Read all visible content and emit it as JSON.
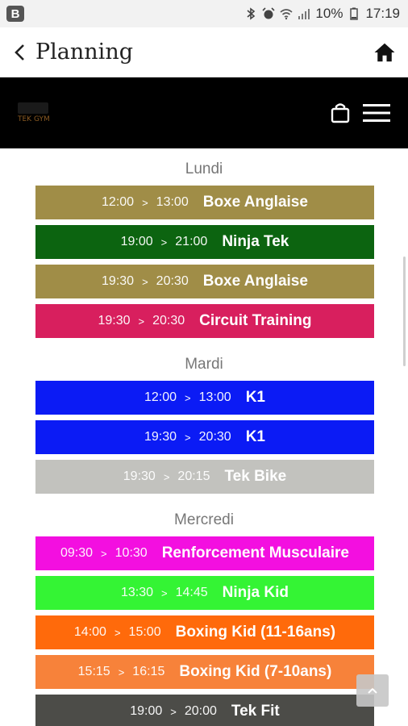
{
  "status_bar": {
    "badge": "B",
    "battery": "10%",
    "time": "17:19",
    "icons": [
      "bluetooth-icon",
      "alarm-icon",
      "wifi-icon",
      "signal-icon",
      "battery-icon"
    ]
  },
  "app_bar": {
    "title": "Planning",
    "back_icon": "chevron-left-icon",
    "home_icon": "home-icon"
  },
  "header": {
    "logo_text": "TEK GYM",
    "bag_icon": "shopping-bag-icon",
    "menu_icon": "hamburger-menu-icon"
  },
  "schedule": [
    {
      "day": "Lundi",
      "items": [
        {
          "start": "12:00",
          "end": "13:00",
          "name": "Boxe Anglaise",
          "color": "#a08d47"
        },
        {
          "start": "19:00",
          "end": "21:00",
          "name": "Ninja Tek",
          "color": "#0c6410"
        },
        {
          "start": "19:30",
          "end": "20:30",
          "name": "Boxe Anglaise",
          "color": "#a08d47"
        },
        {
          "start": "19:30",
          "end": "20:30",
          "name": "Circuit Training",
          "color": "#d81f5e"
        }
      ]
    },
    {
      "day": "Mardi",
      "items": [
        {
          "start": "12:00",
          "end": "13:00",
          "name": "K1",
          "color": "#0b1bf5"
        },
        {
          "start": "19:30",
          "end": "20:30",
          "name": "K1",
          "color": "#0b1bf5"
        },
        {
          "start": "19:30",
          "end": "20:15",
          "name": "Tek Bike",
          "color": "#c2c2be"
        }
      ]
    },
    {
      "day": "Mercredi",
      "items": [
        {
          "start": "09:30",
          "end": "10:30",
          "name": "Renforcement Musculaire",
          "color": "#f30fe0"
        },
        {
          "start": "13:30",
          "end": "14:45",
          "name": "Ninja Kid",
          "color": "#34f434"
        },
        {
          "start": "14:00",
          "end": "15:00",
          "name": "Boxing Kid (11-16ans)",
          "color": "#ff6a0b"
        },
        {
          "start": "15:15",
          "end": "16:15",
          "name": "Boxing Kid (7-10ans)",
          "color": "#f7823a"
        },
        {
          "start": "19:00",
          "end": "20:00",
          "name": "Tek Fit",
          "color": "#4c4c48"
        }
      ]
    }
  ],
  "arrow_glyph": ">",
  "scroll_top_icon": "chevron-up-icon"
}
